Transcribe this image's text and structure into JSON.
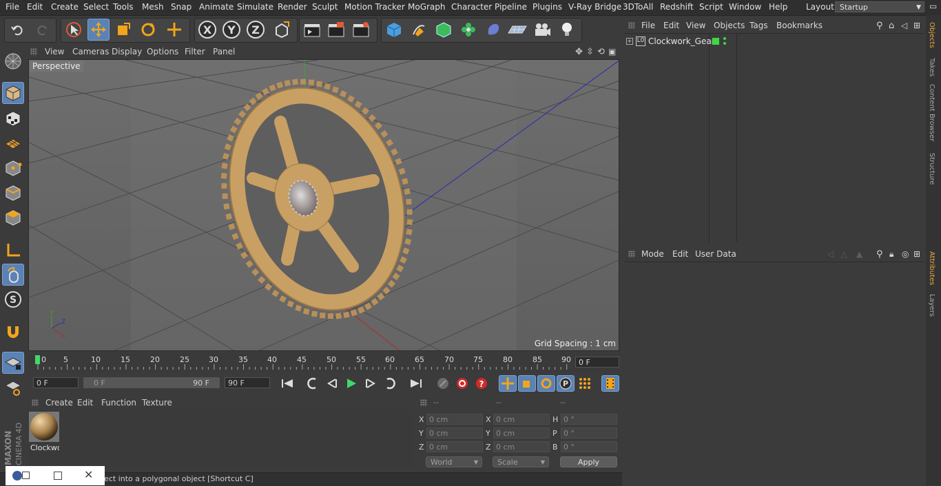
{
  "menubar": {
    "items": [
      "File",
      "Edit",
      "Create",
      "Select",
      "Tools",
      "Mesh",
      "Snap",
      "Animate",
      "Simulate",
      "Render",
      "Sculpt",
      "Motion Tracker",
      "MoGraph",
      "Character",
      "Pipeline",
      "Plugins",
      "V-Ray Bridge",
      "3DToAll",
      "Redshift",
      "Script",
      "Window",
      "Help"
    ],
    "layout_label": "Layout:",
    "layout_value": "Startup"
  },
  "viewport": {
    "menu": [
      "View",
      "Cameras",
      "Display",
      "Options",
      "Filter",
      "Panel"
    ],
    "label": "Perspective",
    "grid_spacing": "Grid Spacing : 1 cm"
  },
  "timeline": {
    "ticks": [
      "0",
      "5",
      "10",
      "15",
      "20",
      "25",
      "30",
      "35",
      "40",
      "45",
      "50",
      "55",
      "60",
      "65",
      "70",
      "75",
      "80",
      "85",
      "90"
    ],
    "current_frame": "0 F"
  },
  "transport": {
    "start_field": "0 F",
    "range_start": "0 F",
    "range_end": "90 F",
    "end_field": "90 F"
  },
  "material_manager": {
    "menu": [
      "Create",
      "Edit",
      "Function",
      "Texture"
    ],
    "material_name": "Clockwo"
  },
  "coordinates": {
    "headers": [
      "--",
      "--",
      "--"
    ],
    "pos_labels": [
      "X",
      "Y",
      "Z"
    ],
    "size_labels": [
      "X",
      "Y",
      "Z"
    ],
    "rot_labels": [
      "H",
      "P",
      "B"
    ],
    "pos_values": [
      "0 cm",
      "0 cm",
      "0 cm"
    ],
    "size_values": [
      "0 cm",
      "0 cm",
      "0 cm"
    ],
    "rot_values": [
      "0 °",
      "0 °",
      "0 °"
    ],
    "mode_dropdown": "World",
    "scale_dropdown": "Scale",
    "apply_label": "Apply"
  },
  "object_manager": {
    "menu": [
      "File",
      "Edit",
      "View",
      "Objects",
      "Tags",
      "Bookmarks"
    ],
    "objects": [
      {
        "name": "Clockwork_Gear"
      }
    ]
  },
  "attribute_manager": {
    "menu": [
      "Mode",
      "Edit",
      "User Data"
    ]
  },
  "right_tabs": [
    "Objects",
    "Takes",
    "Content Browser",
    "Structure",
    "Attributes",
    "Layers"
  ],
  "status": {
    "text": "ject into a polygonal object [Shortcut C]"
  },
  "branding": {
    "maxon": "MAXON",
    "product": "CINEMA 4D"
  },
  "colors": {
    "accent_blue": "#5a82b4",
    "active_tab": "#e6a840",
    "gear_wood": "#c8a064"
  }
}
